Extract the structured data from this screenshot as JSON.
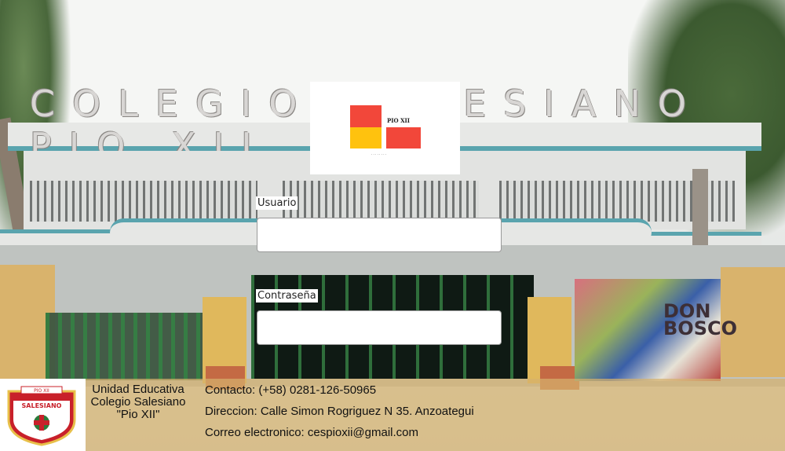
{
  "logo": {
    "wordmark": "PIO XII",
    "tagline": "· · · · · · · ·"
  },
  "background": {
    "sign_text": "COLEGIO SALESIANO PIO XII",
    "mural_text": "DON BOSCO"
  },
  "form": {
    "username_label": "Usuario",
    "username_value": "",
    "password_label": "Contraseña",
    "password_value": ""
  },
  "footer": {
    "crest_text": "SALESIANO",
    "crest_banner": "PIO XII",
    "school_line1": "Unidad Educativa",
    "school_line2": "Colegio Salesiano",
    "school_line3": "\"Pio XII\"",
    "contact": "Contacto: (+58) 0281-126-50965",
    "address": "Direccion: Calle Simon Rogriguez N 35. Anzoategui",
    "email": "Correo electronico: cespioxii@gmail.com"
  },
  "colors": {
    "logo_red": "#f2473a",
    "logo_yellow": "#ffc20e",
    "footer_bg": "#d5b26c"
  }
}
